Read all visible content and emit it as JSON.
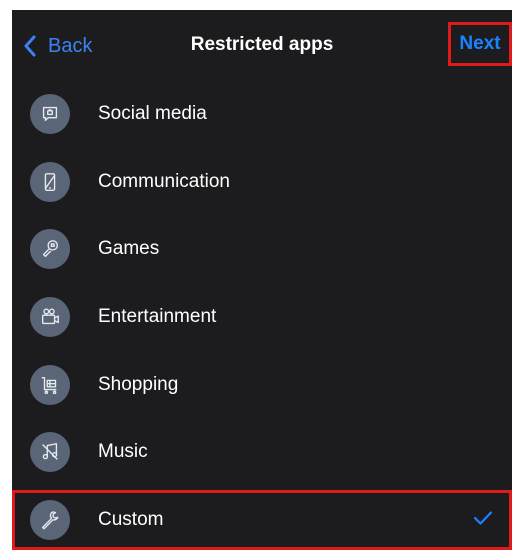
{
  "header": {
    "back_label": "Back",
    "title": "Restricted apps",
    "next_label": "Next"
  },
  "categories": [
    {
      "label": "Social media",
      "icon": "social-media-icon",
      "selected": false
    },
    {
      "label": "Communication",
      "icon": "communication-icon",
      "selected": false
    },
    {
      "label": "Games",
      "icon": "games-icon",
      "selected": false
    },
    {
      "label": "Entertainment",
      "icon": "entertainment-icon",
      "selected": false
    },
    {
      "label": "Shopping",
      "icon": "shopping-icon",
      "selected": false
    },
    {
      "label": "Music",
      "icon": "music-icon",
      "selected": false
    },
    {
      "label": "Custom",
      "icon": "custom-icon",
      "selected": true
    }
  ],
  "colors": {
    "background": "#1c1c1e",
    "accent": "#1a84ff",
    "icon_circle": "#5a6578",
    "highlight": "#e01a1a"
  }
}
